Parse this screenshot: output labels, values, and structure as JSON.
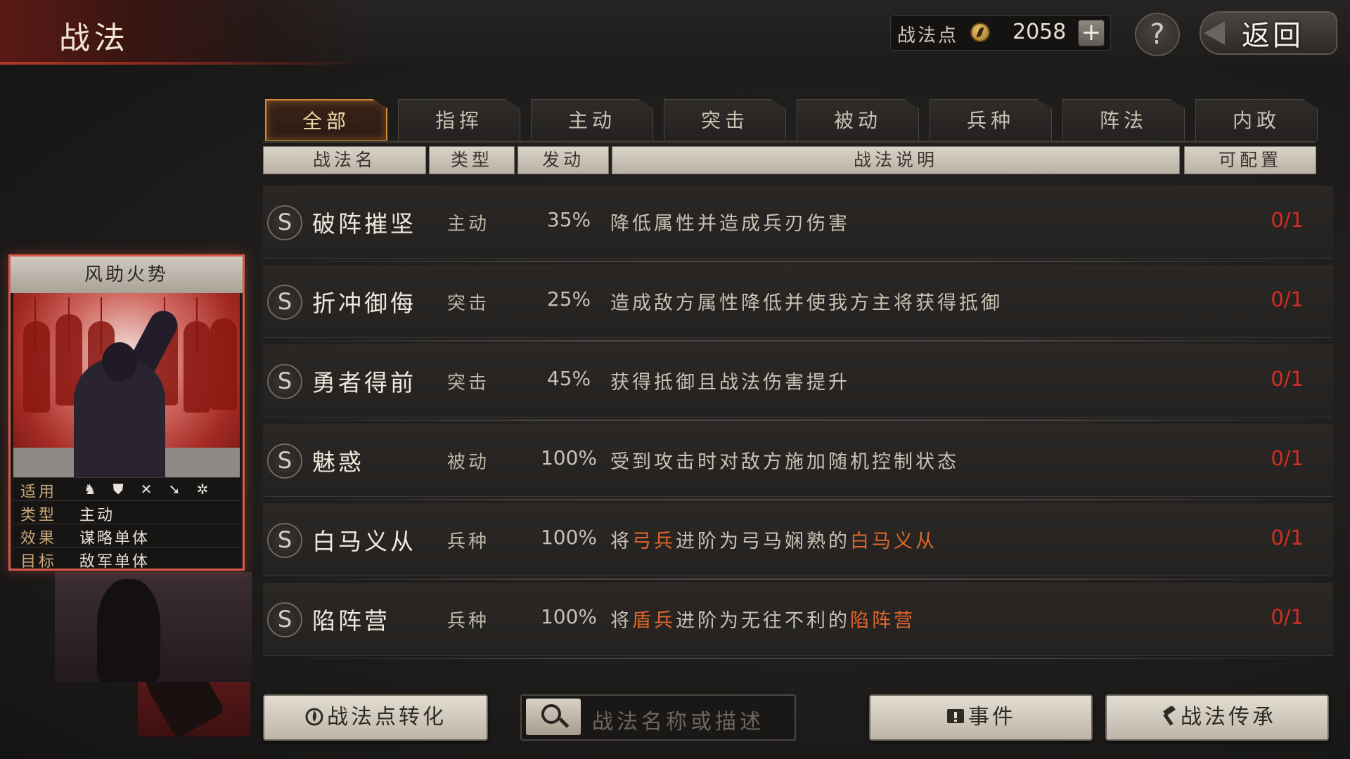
{
  "header": {
    "title": "战法",
    "points_label": "战法点",
    "points_value": "2058",
    "plus_label": "+",
    "help_label": "?",
    "back_label": "返回"
  },
  "tabs": [
    {
      "label": "全部",
      "active": true
    },
    {
      "label": "指挥"
    },
    {
      "label": "主动"
    },
    {
      "label": "突击"
    },
    {
      "label": "被动"
    },
    {
      "label": "兵种"
    },
    {
      "label": "阵法"
    },
    {
      "label": "内政"
    }
  ],
  "columns": [
    "战法名",
    "类型",
    "发动",
    "战法说明",
    "可配置"
  ],
  "skills": [
    {
      "grade": "S",
      "name": "破阵摧坚",
      "type": "主动",
      "rate": "35%",
      "desc": "降低属性并造成兵刃伤害",
      "count": "0/1"
    },
    {
      "grade": "S",
      "name": "折冲御侮",
      "type": "突击",
      "rate": "25%",
      "desc": "造成敌方属性降低并使我方主将获得抵御",
      "count": "0/1"
    },
    {
      "grade": "S",
      "name": "勇者得前",
      "type": "突击",
      "rate": "45%",
      "desc": "获得抵御且战法伤害提升",
      "count": "0/1"
    },
    {
      "grade": "S",
      "name": "魅惑",
      "type": "被动",
      "rate": "100%",
      "desc": "受到攻击时对敌方施加随机控制状态",
      "count": "0/1"
    },
    {
      "grade": "S",
      "name": "白马义从",
      "type": "兵种",
      "rate": "100%",
      "desc_parts": [
        "将",
        "弓兵",
        "进阶为弓马娴熟的",
        "白马义从"
      ],
      "count": "0/1"
    },
    {
      "grade": "S",
      "name": "陷阵营",
      "type": "兵种",
      "rate": "100%",
      "desc_parts": [
        "将",
        "盾兵",
        "进阶为无往不利的",
        "陷阵营"
      ],
      "count": "0/1"
    }
  ],
  "card": {
    "title": "风助火势",
    "info": [
      {
        "key": "适用",
        "value": ""
      },
      {
        "key": "类型",
        "value": "主动"
      },
      {
        "key": "效果",
        "value": "谋略单体"
      },
      {
        "key": "目标",
        "value": "敌军单体"
      }
    ],
    "troop_icons": [
      "cavalry-icon",
      "shield-icon",
      "archer-icon",
      "spear-icon",
      "siege-icon"
    ]
  },
  "footer": {
    "convert_label": "战法点转化",
    "search_placeholder": "战法名称或描述",
    "event_label": "事件",
    "inherit_label": "战法传承"
  },
  "colors": {
    "accent_red": "#d22e22",
    "highlight_orange": "#e0662c",
    "active_tab_border": "#d68a3a",
    "card_border": "#d85a4a"
  }
}
